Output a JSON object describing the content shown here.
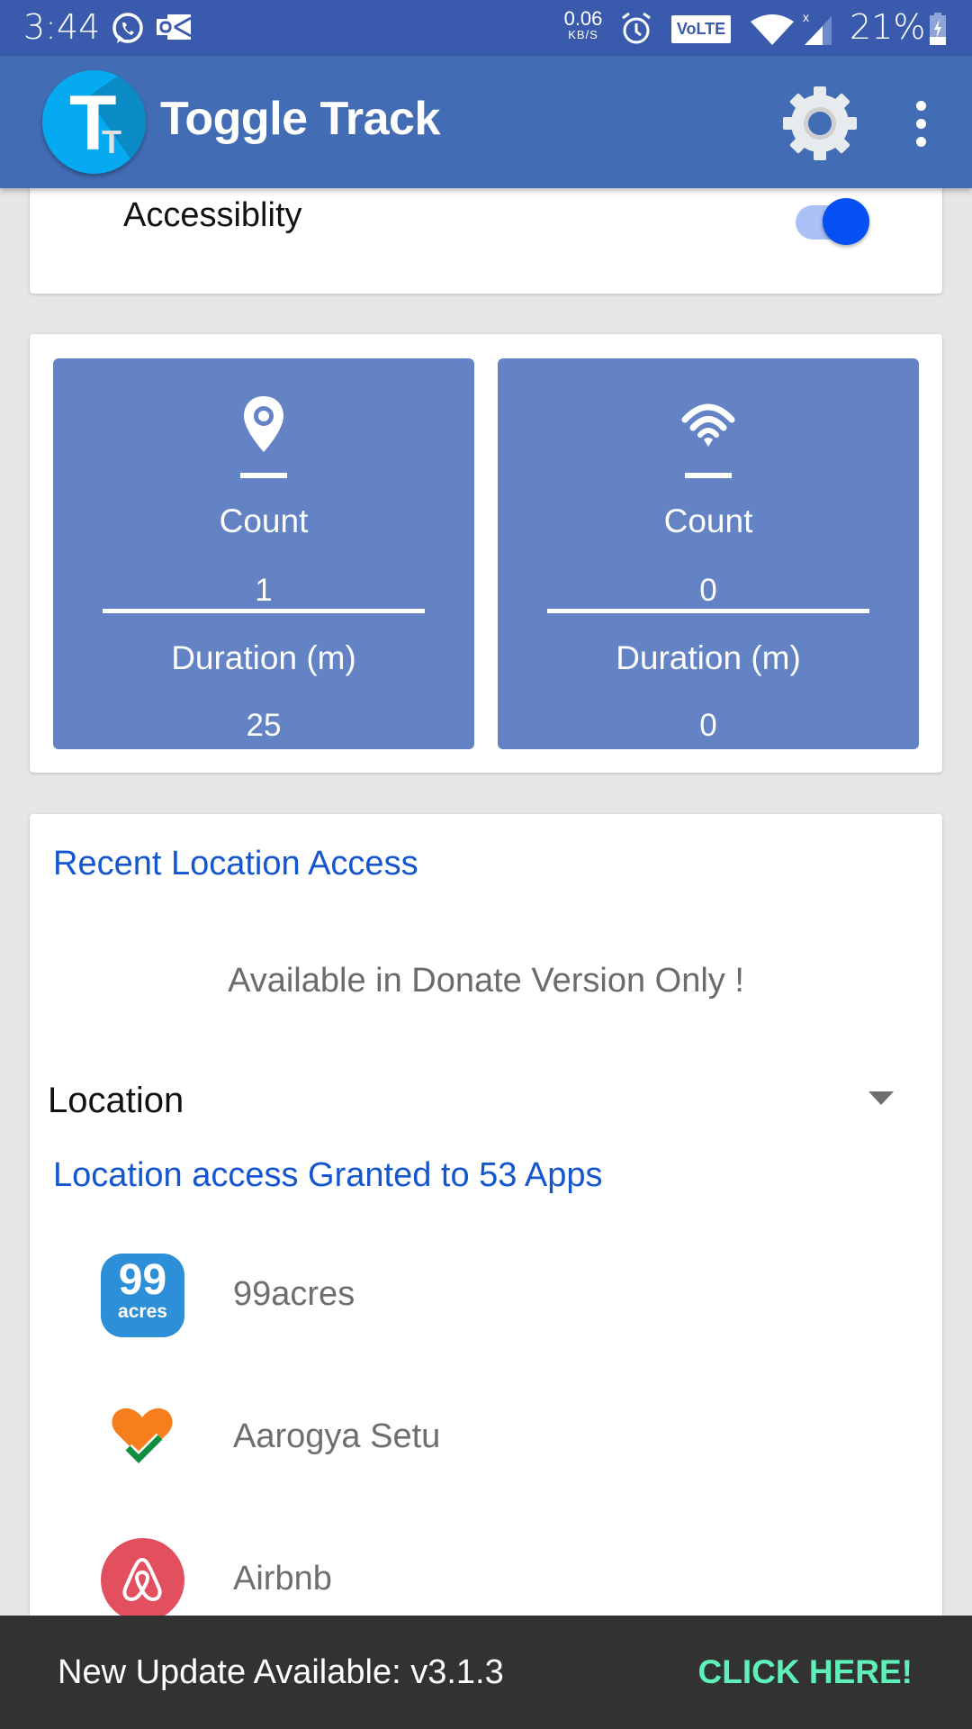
{
  "status_bar": {
    "time": "3:44",
    "notification_icons": [
      "whatsapp-icon",
      "outlook-icon"
    ],
    "network_speed_value": "0.06",
    "network_speed_unit": "KB/S",
    "volte_label": "VoLTE",
    "battery_percent": "21%"
  },
  "app_bar": {
    "logo_letters": "T",
    "logo_small_letter": "T",
    "title": "Toggle Track"
  },
  "accessibility_card": {
    "label": "Accessiblity",
    "toggle_on": true
  },
  "stats": {
    "tiles": [
      {
        "icon": "location-pin-icon",
        "count_label": "Count",
        "count_value": "1",
        "duration_label": "Duration (m)",
        "duration_value": "25"
      },
      {
        "icon": "wifi-icon",
        "count_label": "Count",
        "count_value": "0",
        "duration_label": "Duration (m)",
        "duration_value": "0"
      }
    ]
  },
  "location_card": {
    "recent_title": "Recent Location Access",
    "donate_message": "Available in Donate Version Only !",
    "permission_select": "Location",
    "granted_text": "Location access Granted to 53 Apps",
    "apps": [
      {
        "name": "99acres",
        "icon": "99acres-icon",
        "icon_number": "99",
        "icon_word": "acres"
      },
      {
        "name": "Aarogya Setu",
        "icon": "aarogya-setu-icon"
      },
      {
        "name": "Airbnb",
        "icon": "airbnb-icon"
      }
    ]
  },
  "snackbar": {
    "message": "New Update Available: v3.1.3",
    "action": "CLICK HERE!"
  },
  "colors": {
    "status_bar": "#3a5bad",
    "app_bar": "#426cb4",
    "tile": "#6383c5",
    "accent_text": "#1455d0",
    "toggle_thumb": "#0550f5",
    "snackbar_action": "#5ef0b8"
  }
}
